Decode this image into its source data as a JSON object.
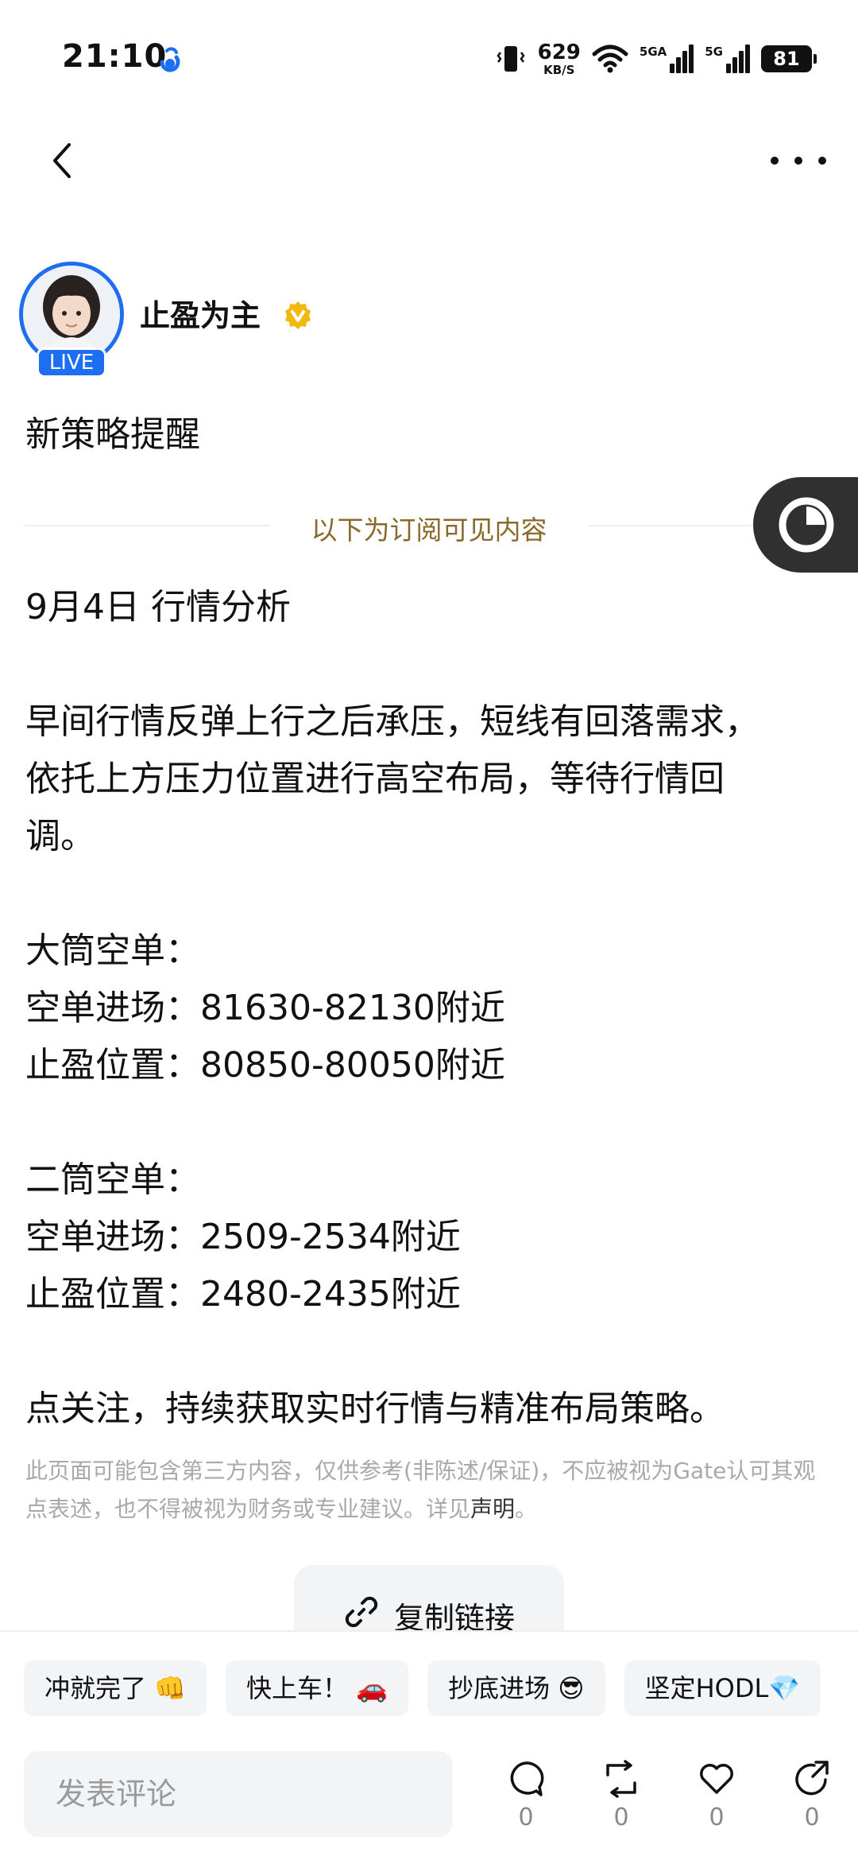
{
  "status_bar": {
    "time": "21:10",
    "speed_value": "629",
    "speed_unit": "KB/S",
    "sim1_label": "5GA",
    "sim2_label": "5G",
    "battery": "81"
  },
  "author": {
    "name": "止盈为主",
    "live_badge": "LIVE"
  },
  "post": {
    "title": "新策略提醒",
    "subscription_divider": "以下为订阅可见内容",
    "lines": [
      "9月4日 行情分析",
      "",
      "早间行情反弹上行之后承压，短线有回落需求，",
      "依托上方压力位置进行高空布局，等待行情回",
      "调。",
      "",
      "大筒空单：",
      "空单进场：81630-82130附近",
      "止盈位置：80850-80050附近",
      "",
      "二筒空单：",
      "空单进场：2509-2534附近",
      "止盈位置：2480-2435附近",
      "",
      "点关注，持续获取实时行情与精准布局策略。"
    ]
  },
  "disclaimer": {
    "text": "此页面可能包含第三方内容，仅供参考(非陈述/保证)，不应被视为Gate认可其观点表述，也不得被视为财务或专业建议。详见",
    "link": "声明",
    "suffix": "。"
  },
  "copy_link_label": "复制链接",
  "quick_replies": [
    "冲就完了 👊",
    "快上车！ 🚗",
    "抄底进场 😎",
    "坚定HODL💎"
  ],
  "comment": {
    "placeholder": "发表评论"
  },
  "actions": {
    "comment_count": "0",
    "repost_count": "0",
    "like_count": "0",
    "share_count": "0"
  },
  "colors": {
    "accent": "#1e6ff0",
    "subscription_text": "#8a6a2a",
    "verified": "#f0b90b"
  }
}
